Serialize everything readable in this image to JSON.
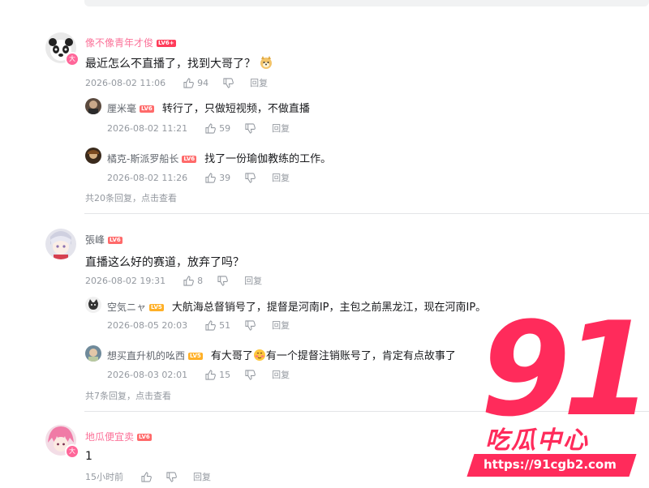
{
  "comments": [
    {
      "username": "像不像青年才俊",
      "level": "LV6+",
      "text": "最近怎么不直播了，找到大哥了？",
      "emoji": "doge-emoji",
      "time": "2026-08-02 11:06",
      "likes": "94",
      "reply_label": "回复",
      "replies": [
        {
          "username": "厘米毫",
          "level": "LV6",
          "text": "转行了，只做短视频，不做直播",
          "time": "2026-08-02 11:21",
          "likes": "59",
          "reply_label": "回复"
        },
        {
          "username": "橘克-斯派罗船长",
          "level": "LV6",
          "text": "找了一份瑜伽教练的工作。",
          "time": "2026-08-02 11:26",
          "likes": "39",
          "reply_label": "回复"
        }
      ],
      "more": "共20条回复，点击查看"
    },
    {
      "username": "張峰",
      "level": "LV6",
      "text": "直播这么好的赛道，放弃了吗？",
      "time": "2026-08-02 19:31",
      "likes": "8",
      "reply_label": "回复",
      "replies": [
        {
          "username": "空気ニャ",
          "level": "LV5",
          "text": "大航海总督销号了，提督是河南IP，主包之前黑龙江，现在河南IP。",
          "time": "2026-08-05 20:03",
          "likes": "51",
          "reply_label": "回复"
        },
        {
          "username": "想买直升机的吆西",
          "level": "LV5",
          "text_a": "有大哥了",
          "text_b": "有一个提督注销账号了，肯定有点故事了",
          "emoji": "blush-emoji",
          "time": "2026-08-03 02:01",
          "likes": "15",
          "reply_label": "回复"
        }
      ],
      "more": "共7条回复，点击查看"
    },
    {
      "username": "地瓜便宜卖",
      "level": "LV6",
      "text": "1",
      "time": "15小时前",
      "likes": "",
      "reply_label": "回复"
    }
  ],
  "watermark": {
    "number": "91",
    "name": "吃瓜中心",
    "url": "https://91cgb2.com"
  },
  "colors": {
    "accent_pink": "#fb7299",
    "watermark_red": "#ff2b5b",
    "meta_gray": "#9499a0"
  }
}
